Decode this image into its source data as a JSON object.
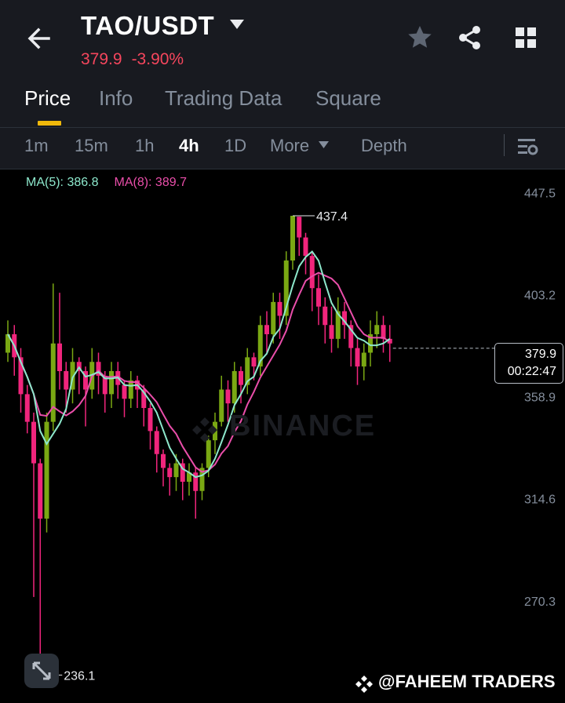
{
  "header": {
    "pair": "TAO/USDT",
    "last_price": "379.9",
    "change_pct": "-3.90%",
    "icons": [
      "back-arrow-icon",
      "caret-down-icon",
      "star-icon",
      "share-icon",
      "grid-icon"
    ]
  },
  "tabs": [
    {
      "label": "Price",
      "active": true
    },
    {
      "label": "Info",
      "active": false
    },
    {
      "label": "Trading Data",
      "active": false
    },
    {
      "label": "Square",
      "active": false
    }
  ],
  "intervals": {
    "items": [
      "1m",
      "15m",
      "1h",
      "4h",
      "1D",
      "More"
    ],
    "active": "4h",
    "depth_label": "Depth"
  },
  "legend": {
    "ma5": "MA(5): 386.8",
    "ma8": "MA(8): 389.7"
  },
  "colors": {
    "up": "#7aa813",
    "down": "#f0257c",
    "ma5": "#8de8cc",
    "ma8": "#ea4eaa",
    "accent": "#f0b90b",
    "negative_text": "#f6465d"
  },
  "price_tag": {
    "price": "379.9",
    "countdown": "00:22:47"
  },
  "watermark": "BINANCE",
  "credit": "@FAHEEM TRADERS",
  "chart_data": {
    "type": "candlestick",
    "y_axis_ticks": [
      "447.5",
      "403.2",
      "358.9",
      "314.6",
      "270.3"
    ],
    "y_tick_values": [
      447.5,
      403.2,
      358.9,
      314.6,
      270.3
    ],
    "ylim": [
      226,
      450
    ],
    "high_label": "437.4",
    "low_label": "236.1",
    "current_price": 379.9,
    "candles": [
      [
        378,
        386,
        374,
        392
      ],
      [
        386,
        376,
        368,
        390
      ],
      [
        376,
        360,
        352,
        380
      ],
      [
        360,
        348,
        343,
        364
      ],
      [
        348,
        330,
        272,
        352
      ],
      [
        330,
        306,
        236.1,
        332
      ],
      [
        306,
        348,
        300,
        352
      ],
      [
        348,
        382,
        344,
        408
      ],
      [
        382,
        370,
        362,
        404
      ],
      [
        370,
        362,
        352,
        374
      ],
      [
        362,
        374,
        356,
        380
      ],
      [
        374,
        370,
        360,
        376
      ],
      [
        370,
        362,
        346,
        372
      ],
      [
        362,
        374,
        358,
        380
      ],
      [
        374,
        368,
        360,
        378
      ],
      [
        368,
        360,
        352,
        370
      ],
      [
        360,
        370,
        354,
        374
      ],
      [
        370,
        364,
        358,
        374
      ],
      [
        364,
        358,
        350,
        366
      ],
      [
        358,
        366,
        354,
        370
      ],
      [
        366,
        362,
        354,
        368
      ],
      [
        362,
        354,
        346,
        364
      ],
      [
        354,
        344,
        336,
        356
      ],
      [
        344,
        334,
        326,
        346
      ],
      [
        334,
        328,
        320,
        336
      ],
      [
        328,
        324,
        316,
        330
      ],
      [
        324,
        330,
        318,
        334
      ],
      [
        330,
        322,
        314,
        332
      ],
      [
        322,
        326,
        316,
        330
      ],
      [
        326,
        318,
        306,
        328
      ],
      [
        318,
        328,
        314,
        330
      ],
      [
        328,
        340,
        324,
        342
      ],
      [
        340,
        348,
        334,
        352
      ],
      [
        348,
        362,
        346,
        368
      ],
      [
        362,
        356,
        348,
        366
      ],
      [
        356,
        370,
        352,
        374
      ],
      [
        370,
        364,
        356,
        372
      ],
      [
        364,
        376,
        360,
        380
      ],
      [
        376,
        372,
        366,
        378
      ],
      [
        372,
        390,
        368,
        394
      ],
      [
        390,
        386,
        378,
        396
      ],
      [
        386,
        400,
        382,
        404
      ],
      [
        400,
        394,
        384,
        404
      ],
      [
        394,
        418,
        390,
        422
      ],
      [
        418,
        437.4,
        414,
        437.4
      ],
      [
        437,
        428,
        420,
        437
      ],
      [
        428,
        420,
        412,
        430
      ],
      [
        420,
        406,
        396,
        422
      ],
      [
        406,
        398,
        390,
        412
      ],
      [
        398,
        390,
        382,
        402
      ],
      [
        390,
        384,
        378,
        398
      ],
      [
        384,
        396,
        380,
        402
      ],
      [
        396,
        390,
        384,
        400
      ],
      [
        390,
        380,
        372,
        392
      ],
      [
        380,
        372,
        364,
        384
      ],
      [
        372,
        378,
        366,
        382
      ],
      [
        378,
        386,
        372,
        392
      ],
      [
        386,
        390,
        380,
        396
      ],
      [
        390,
        384,
        378,
        394
      ],
      [
        384,
        382,
        374,
        390
      ]
    ]
  }
}
